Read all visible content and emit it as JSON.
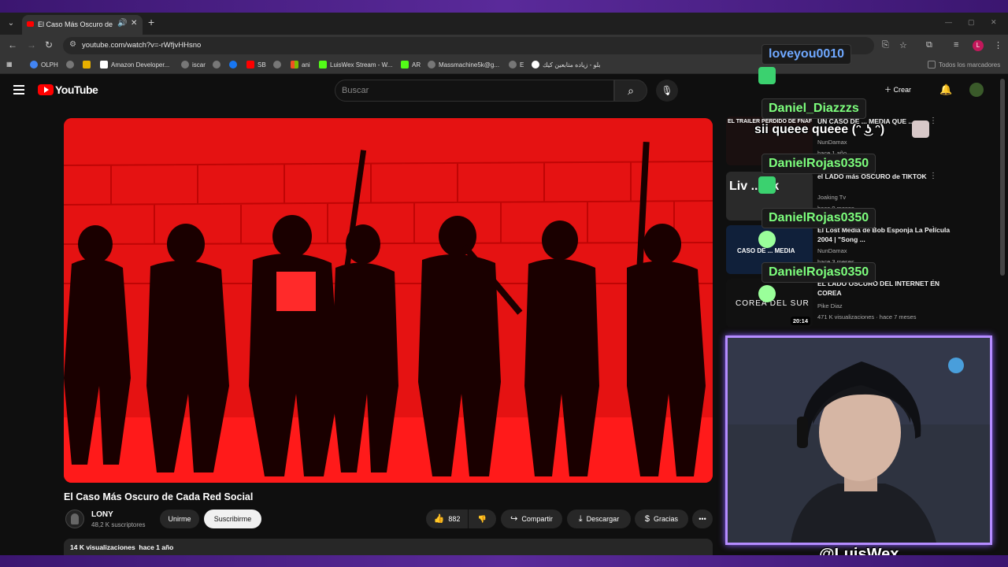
{
  "browser": {
    "tab_title": "El Caso Más Oscuro de Cada",
    "url": "youtube.com/watch?v=-rWfjvHHsno",
    "bookmarks": [
      "OLPH",
      "Amazon Developer...",
      "iscar",
      "SB",
      "ani",
      "LuisWex Stream - W...",
      "AR",
      "Massmachine5k@g...",
      "E",
      "بلو - زياده متابعين كيك"
    ],
    "all_bookmarks": "Todos los marcadores"
  },
  "youtube": {
    "wordmark": "YouTube",
    "search_placeholder": "Buscar",
    "create_label": "Crear"
  },
  "video": {
    "title": "El Caso Más Oscuro de Cada Red Social",
    "channel": "LONY",
    "subscribers": "48,2 K suscriptores",
    "join_label": "Unirme",
    "subscribe_label": "Suscribirme",
    "likes": "882",
    "share_label": "Compartir",
    "download_label": "Descargar",
    "thanks_label": "Gracias",
    "views": "14 K visualizaciones",
    "age": "hace 1 año"
  },
  "recommendations": [
    {
      "title": "UN CASO DE ... MEDIA QUE ... ",
      "channel": "NunDamax",
      "meta": "hace 1 año",
      "thumb_text": "EL TRAILER PERDIDO DE FNAF",
      "thumb_color": "#1a1010",
      "duration": ""
    },
    {
      "title": "el LADO más OSCURO de TIKTOK",
      "channel": "Joaking Tv",
      "meta": "hace 9 meses",
      "thumb_text": "Liv ... ak",
      "thumb_color": "#2a2a2a",
      "duration": ""
    },
    {
      "title": "El Lost Media de Bob Esponja La Película 2004 | \"Song ...",
      "channel": "NunDamax",
      "meta": "hace 3 meses",
      "thumb_text": "CASO DE ... MEDIA",
      "thumb_color": "#10203a",
      "duration": ""
    },
    {
      "title": "EL LADO OSCURO DEL INTERNET EN COREA",
      "channel": "Pike Diaz",
      "meta": "471 K visualizaciones · hace 7 meses",
      "thumb_text": "COREA DEL SUR",
      "thumb_color": "#111",
      "duration": "20:14"
    }
  ],
  "chat": [
    {
      "name": "loveyou0010",
      "color": "blue"
    },
    {
      "name": "Daniel_Diazzzs",
      "color": "green",
      "message": "sii queee queee (ᵔ ͜ʖ ᵔ)"
    },
    {
      "name": "DanielRojas0350",
      "color": "green"
    },
    {
      "name": "DanielRojas0350",
      "color": "green"
    },
    {
      "name": "DanielRojas0350",
      "color": "green"
    }
  ],
  "stream": {
    "watermark": "@LuisWex"
  },
  "colors": {
    "frame_purple": "#3b1670",
    "webcam_border": "#b58cff",
    "yt_red": "#ff0000",
    "video_red": "#e01010"
  }
}
